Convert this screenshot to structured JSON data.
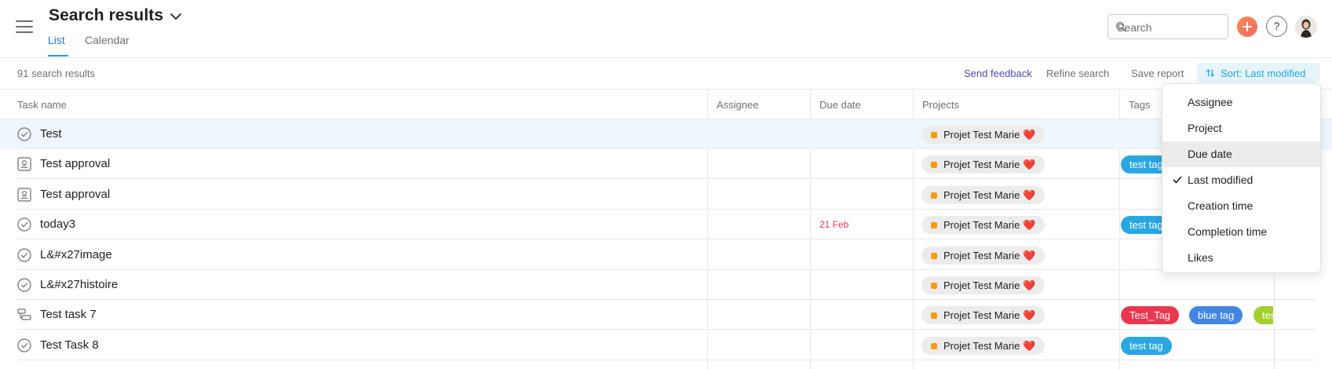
{
  "header": {
    "title": "Search results",
    "tabs": [
      {
        "label": "List",
        "active": true
      },
      {
        "label": "Calendar",
        "active": false
      }
    ],
    "search": {
      "placeholder": "Search",
      "value": ""
    },
    "help_label": "?"
  },
  "toolbar": {
    "results_count": "91 search results",
    "send_feedback": "Send feedback",
    "refine_search": "Refine search",
    "save_report": "Save report",
    "sort_label": "Sort: Last modified"
  },
  "columns": {
    "task_name": "Task name",
    "assignee": "Assignee",
    "due_date": "Due date",
    "projects": "Projects",
    "tags": "Tags"
  },
  "rows": [
    {
      "name": "Test",
      "icon": "check-circle-icon",
      "due": "",
      "project": "Projet Test Marie",
      "project_emoji": "❤️",
      "tags": [],
      "highlight": true
    },
    {
      "name": "Test approval",
      "icon": "approval-icon",
      "due": "",
      "project": "Projet Test Marie",
      "project_emoji": "❤️",
      "tags": [
        {
          "label": "test tag"
        }
      ]
    },
    {
      "name": "Test approval",
      "icon": "approval-icon",
      "due": "",
      "project": "Projet Test Marie",
      "project_emoji": "❤️",
      "tags": []
    },
    {
      "name": "today3",
      "icon": "check-circle-icon",
      "due": "21 Feb",
      "project": "Projet Test Marie",
      "project_emoji": "❤️",
      "tags": [
        {
          "label": "test tag"
        }
      ]
    },
    {
      "name": "L&#x27image",
      "icon": "check-circle-icon",
      "due": "",
      "project": "Projet Test Marie",
      "project_emoji": "❤️",
      "tags": []
    },
    {
      "name": "L&#x27histoire",
      "icon": "check-circle-icon",
      "due": "",
      "project": "Projet Test Marie",
      "project_emoji": "❤️",
      "tags": []
    },
    {
      "name": "Test task 7",
      "icon": "milestone-icon",
      "due": "",
      "project": "Projet Test Marie",
      "project_emoji": "❤️",
      "tags": [
        {
          "label": "Test_Tag"
        },
        {
          "label": "blue tag"
        },
        {
          "label": "test tag"
        }
      ]
    },
    {
      "name": "Test Task 8",
      "icon": "check-circle-icon",
      "due": "",
      "project": "Projet Test Marie",
      "project_emoji": "❤️",
      "tags": [
        {
          "label": "test tag"
        }
      ]
    }
  ],
  "sort_menu": {
    "items": [
      {
        "label": "Assignee",
        "checked": false,
        "hovered": false
      },
      {
        "label": "Project",
        "checked": false,
        "hovered": false
      },
      {
        "label": "Due date",
        "checked": false,
        "hovered": true
      },
      {
        "label": "Last modified",
        "checked": true,
        "hovered": false
      },
      {
        "label": "Creation time",
        "checked": false,
        "hovered": false
      },
      {
        "label": "Completion time",
        "checked": false,
        "hovered": false
      },
      {
        "label": "Likes",
        "checked": false,
        "hovered": false
      }
    ]
  },
  "colors": {
    "accent_blue": "#1f9cdb",
    "tag_blue": "#2aa7e3",
    "tag_red": "#e8384f",
    "tag_navy": "#4186e0",
    "tag_green": "#a4cf30",
    "project_dot": "#fd9a00",
    "due_red": "#e8384f"
  }
}
